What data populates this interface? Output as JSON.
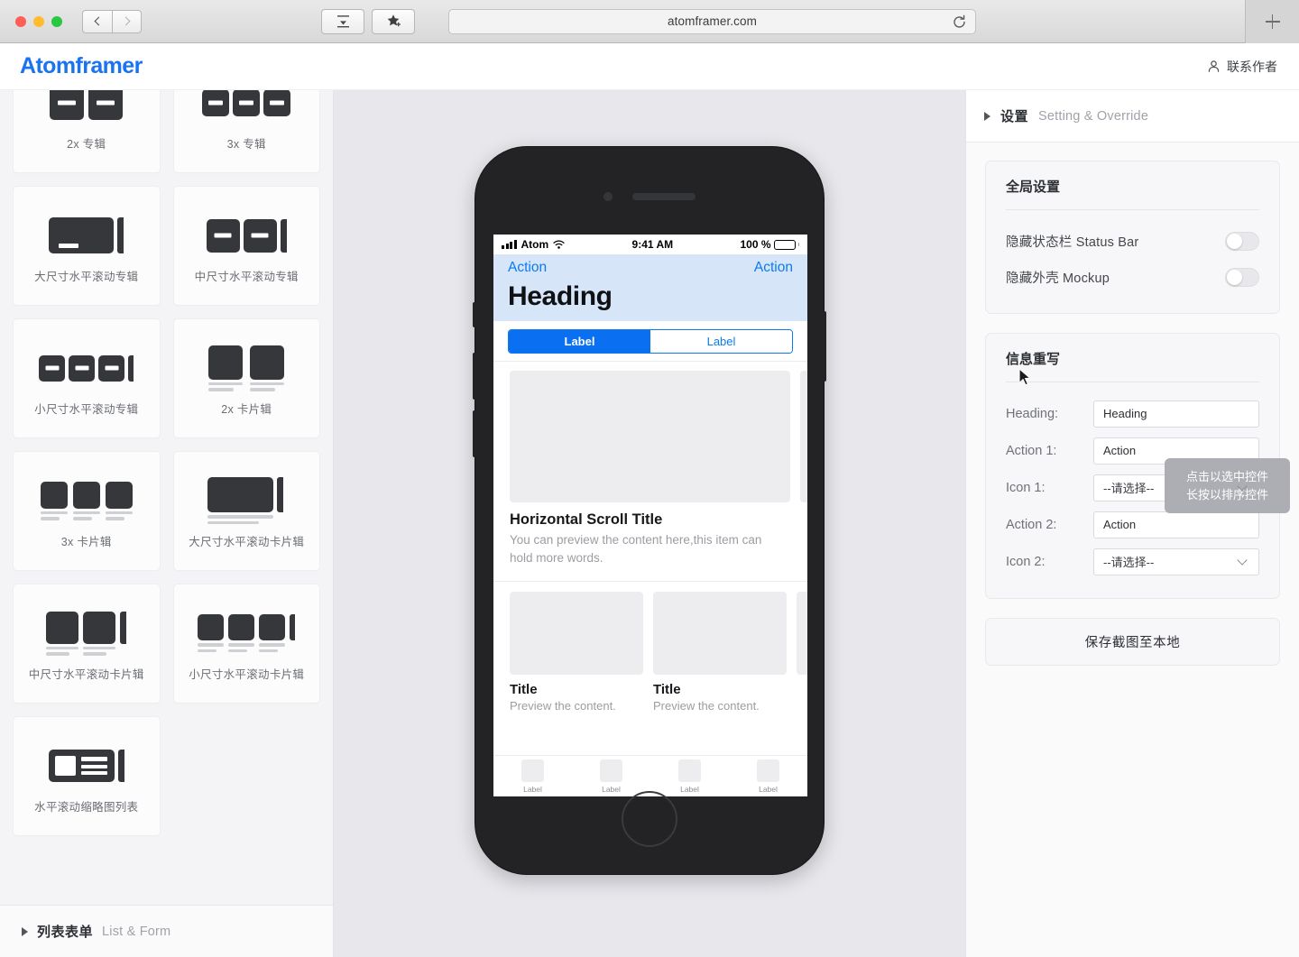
{
  "browser": {
    "url": "atomframer.com",
    "back_icon": "chevron-left-icon",
    "forward_icon": "chevron-right-icon",
    "sidebar_icon": "show-tab-overview-icon",
    "bookmark_icon": "add-bookmark-star-icon",
    "reload_icon": "reload-icon",
    "new_tab_icon": "plus-icon"
  },
  "header": {
    "logo": "Atomframer",
    "contact_label": "联系作者",
    "contact_icon": "person-icon"
  },
  "sidebar": {
    "components": [
      {
        "label": "2x 专辑",
        "icon": "album-2x-icon"
      },
      {
        "label": "3x 专辑",
        "icon": "album-3x-icon"
      },
      {
        "label": "大尺寸水平滚动专辑",
        "icon": "hscroll-album-large-icon"
      },
      {
        "label": "中尺寸水平滚动专辑",
        "icon": "hscroll-album-medium-icon"
      },
      {
        "label": "小尺寸水平滚动专辑",
        "icon": "hscroll-album-small-icon"
      },
      {
        "label": "2x 卡片辑",
        "icon": "card-2x-icon"
      },
      {
        "label": "3x 卡片辑",
        "icon": "card-3x-icon"
      },
      {
        "label": "大尺寸水平滚动卡片辑",
        "icon": "hscroll-card-large-icon"
      },
      {
        "label": "中尺寸水平滚动卡片辑",
        "icon": "hscroll-card-medium-icon"
      },
      {
        "label": "小尺寸水平滚动卡片辑",
        "icon": "hscroll-card-small-icon"
      },
      {
        "label": "水平滚动缩略图列表",
        "icon": "hscroll-thumbnail-list-icon"
      }
    ],
    "footer_section": {
      "cn": "列表表单",
      "en": "List & Form",
      "disclosure_icon": "triangle-right-icon"
    }
  },
  "canvas": {
    "tooltip_line1": "点击以选中控件",
    "tooltip_line2": "长按以排序控件",
    "phone": {
      "status_bar": {
        "carrier": "Atom",
        "time": "9:41 AM",
        "battery_percent": "100 %",
        "signal_icon": "signal-bars-icon",
        "wifi_icon": "wifi-icon",
        "battery_icon": "battery-full-icon"
      },
      "nav": {
        "action_left": "Action",
        "action_right": "Action",
        "heading": "Heading"
      },
      "segmented": {
        "left": "Label",
        "right": "Label"
      },
      "hscroll_item": {
        "title": "Horizontal Scroll Title",
        "description": "You can preview the content here,this item can hold more words."
      },
      "cards": [
        {
          "title": "Title",
          "description": "Preview the content."
        },
        {
          "title": "Title",
          "description": "Preview the content."
        }
      ],
      "tabbar": [
        {
          "label": "Label",
          "icon": "tab-placeholder-icon"
        },
        {
          "label": "Label",
          "icon": "tab-placeholder-icon"
        },
        {
          "label": "Label",
          "icon": "tab-placeholder-icon"
        },
        {
          "label": "Label",
          "icon": "tab-placeholder-icon"
        }
      ]
    }
  },
  "right_panel": {
    "section_header": {
      "cn": "设置",
      "en": "Setting & Override",
      "disclosure_icon": "triangle-right-icon"
    },
    "global": {
      "title": "全局设置",
      "rows": [
        {
          "label": "隐藏状态栏  Status Bar",
          "state": "off"
        },
        {
          "label": "隐藏外壳  Mockup",
          "state": "off"
        }
      ]
    },
    "override": {
      "title": "信息重写",
      "fields": [
        {
          "label": "Heading:",
          "type": "text",
          "value": "Heading"
        },
        {
          "label": "Action 1:",
          "type": "text",
          "value": "Action"
        },
        {
          "label": "Icon 1:",
          "type": "select",
          "value": "--请选择--"
        },
        {
          "label": "Action 2:",
          "type": "text",
          "value": "Action"
        },
        {
          "label": "Icon 2:",
          "type": "select",
          "value": "--请选择--"
        }
      ]
    },
    "save_label": "保存截图至本地"
  },
  "colors": {
    "brand": "#1a73f0",
    "ios_blue": "#0a7bf0",
    "navbar_bg": "#d6e5f8",
    "canvas_bg": "#e7e7ec"
  }
}
